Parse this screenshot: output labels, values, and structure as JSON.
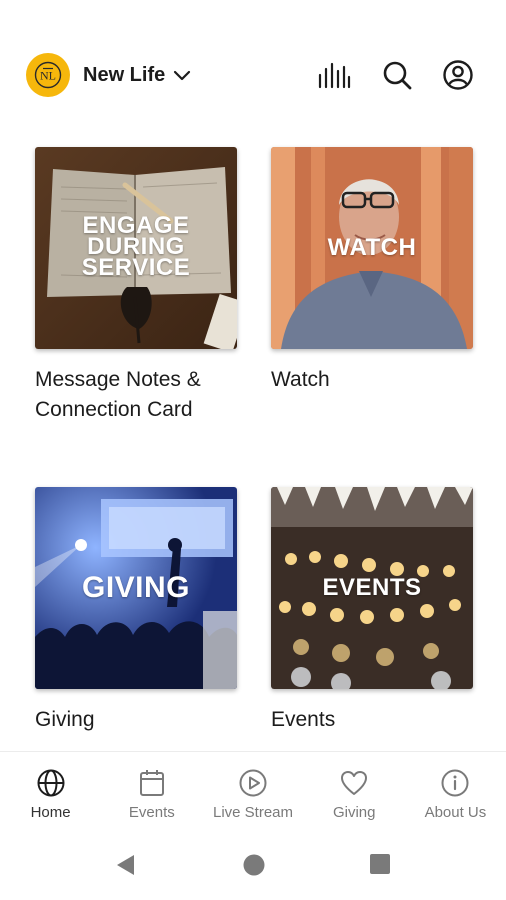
{
  "header": {
    "org_name": "New Life",
    "logo_text": "NL",
    "logo_color": "#f6b70c",
    "icons": [
      "chevron-down-icon",
      "audio-bars-icon",
      "search-icon",
      "account-icon"
    ]
  },
  "tiles": [
    {
      "overlay_lines": [
        "ENGAGE",
        "DURING",
        "SERVICE"
      ],
      "title": "Message Notes & Connection Card"
    },
    {
      "overlay_lines": [
        "WATCH"
      ],
      "title": "Watch"
    },
    {
      "overlay_lines": [
        "GIVING"
      ],
      "title": "Giving"
    },
    {
      "overlay_lines": [
        "EVENTS"
      ],
      "title": "Events"
    }
  ],
  "bottom_nav": {
    "active": "Home",
    "items": [
      {
        "label": "Home",
        "icon": "globe-icon"
      },
      {
        "label": "Events",
        "icon": "calendar-icon"
      },
      {
        "label": "Live Stream",
        "icon": "play-circle-icon"
      },
      {
        "label": "Giving",
        "icon": "heart-icon"
      },
      {
        "label": "About Us",
        "icon": "info-icon"
      }
    ]
  },
  "system_nav": {
    "icons": [
      "back-icon",
      "home-icon",
      "recents-icon"
    ]
  }
}
